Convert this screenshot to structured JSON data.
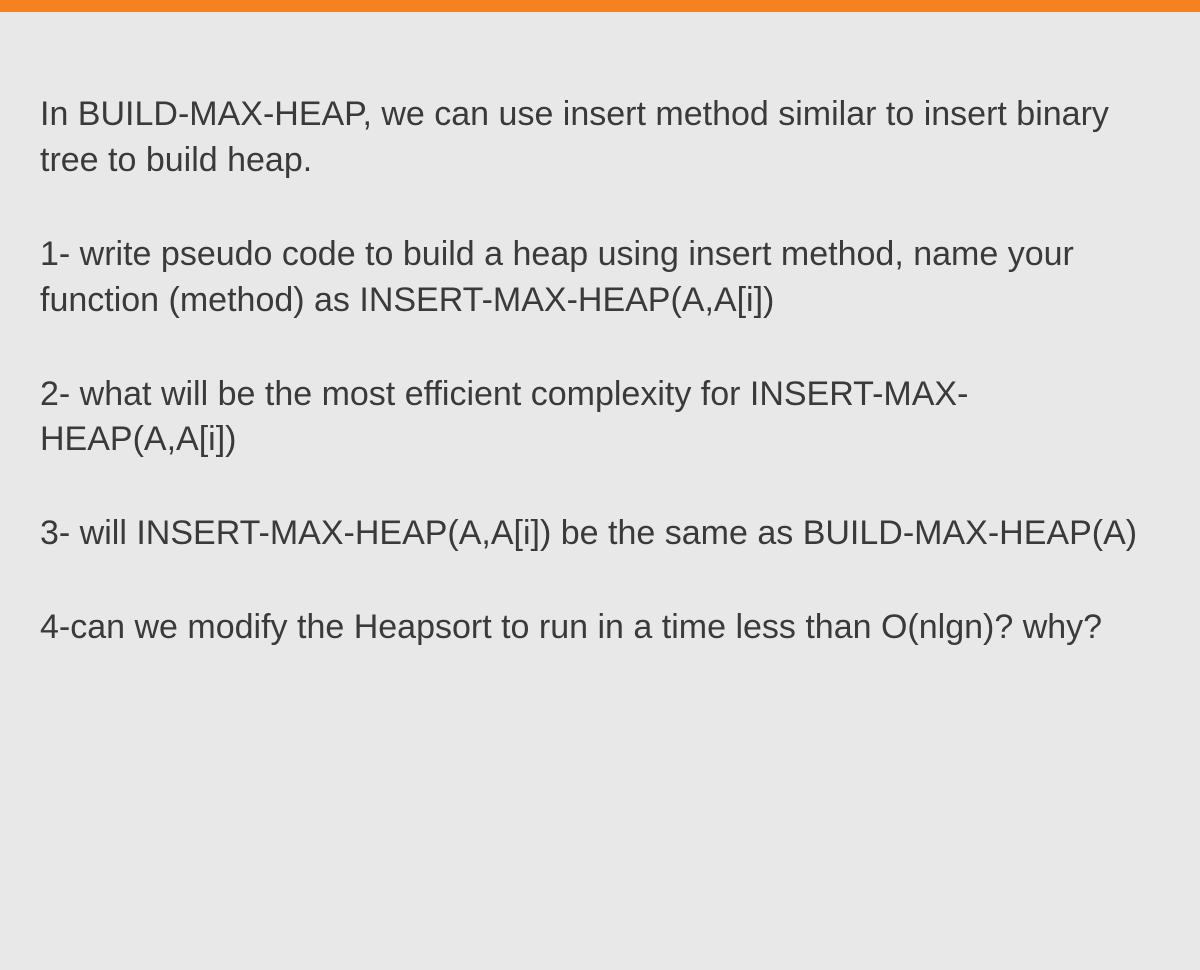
{
  "paragraphs": {
    "intro": "In BUILD-MAX-HEAP, we can use insert method similar to insert binary tree to build heap.",
    "q1": "1- write pseudo code to build a heap using insert method, name your function (method) as INSERT-MAX-HEAP(A,A[i])",
    "q2": "2- what will be the most efficient complexity for INSERT-MAX-HEAP(A,A[i])",
    "q3": "3- will INSERT-MAX-HEAP(A,A[i]) be the same as BUILD-MAX-HEAP(A)",
    "q4": "4-can we modify the Heapsort to run in a time less than O(nlgn)? why?"
  }
}
